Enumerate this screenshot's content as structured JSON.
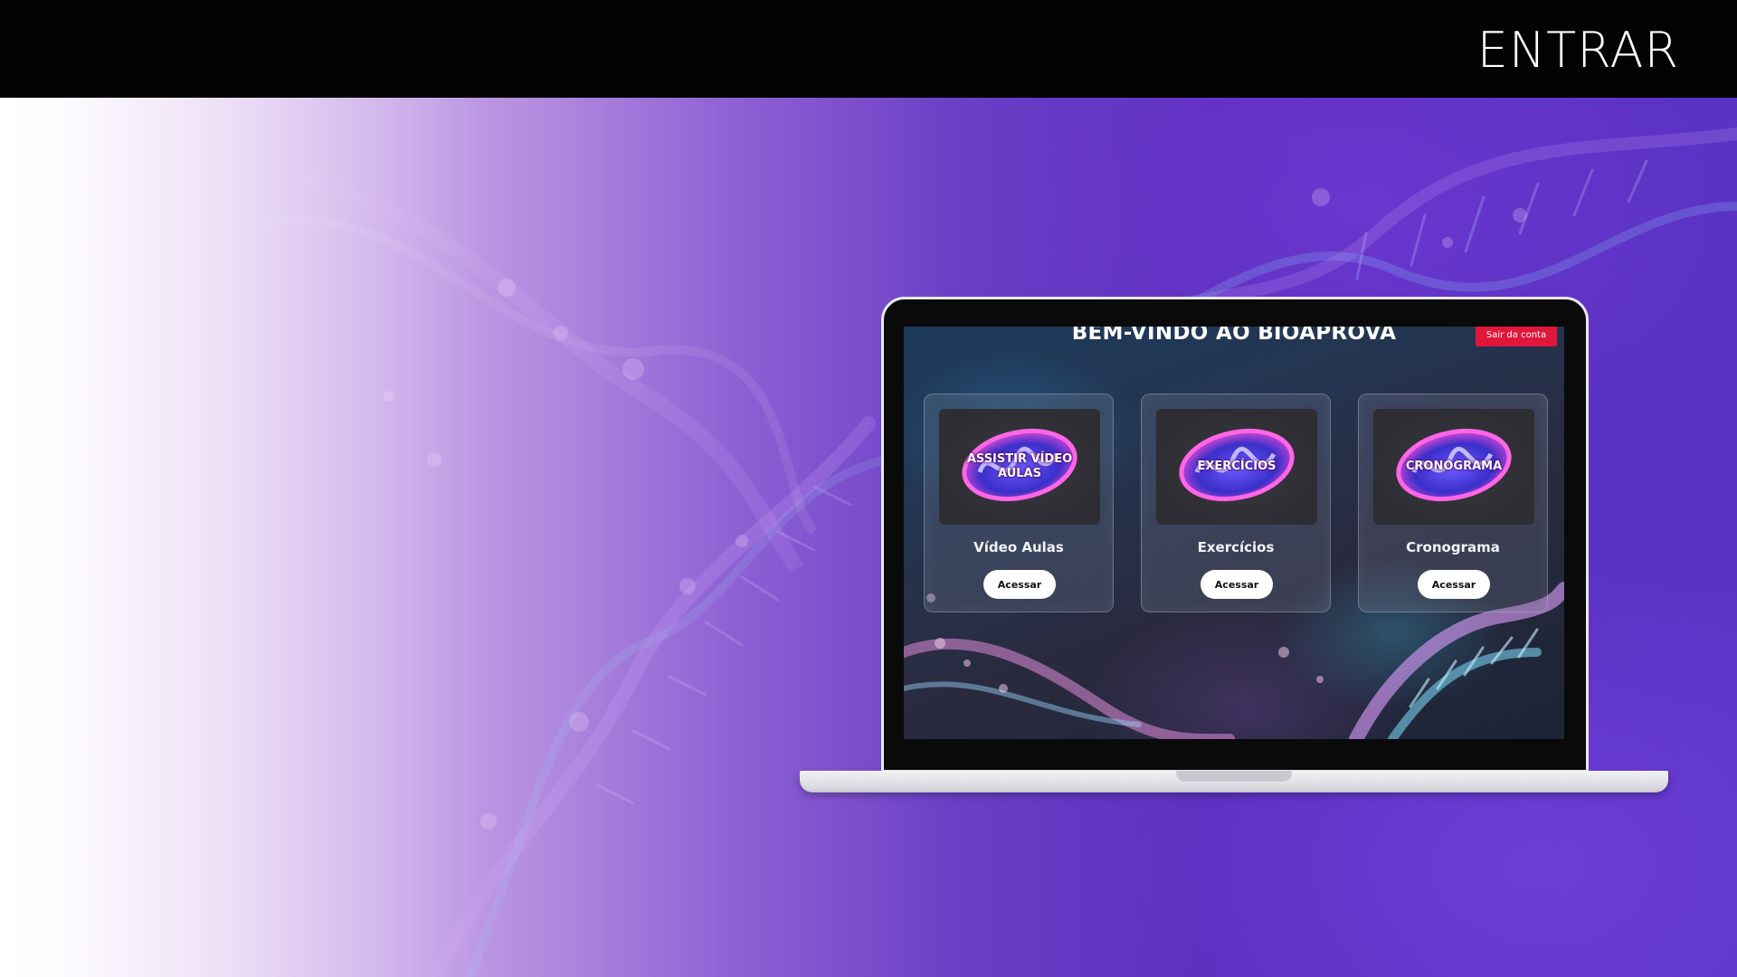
{
  "header": {
    "login_label": "ENTRAR"
  },
  "screen": {
    "title": "BEM-VINDO AO BIOAPROVA",
    "logout_label": "Sair da conta",
    "cards": [
      {
        "thumb_text": "ASSISTIR VÍDEO AULAS",
        "title": "Vídeo Aulas",
        "button": "Acessar"
      },
      {
        "thumb_text": "EXERCÍCIOS",
        "title": "Exercícios",
        "button": "Acessar"
      },
      {
        "thumb_text": "CRONOGRAMA",
        "title": "Cronograma",
        "button": "Acessar"
      }
    ]
  },
  "colors": {
    "topbar": "#020202",
    "logout": "#e0163b",
    "hero_purple": "#5a2fbc",
    "accent_magenta": "#e040ff"
  },
  "icons": [
    "dna-helix-background",
    "mitochondria-icon",
    "laptop-mockup"
  ]
}
